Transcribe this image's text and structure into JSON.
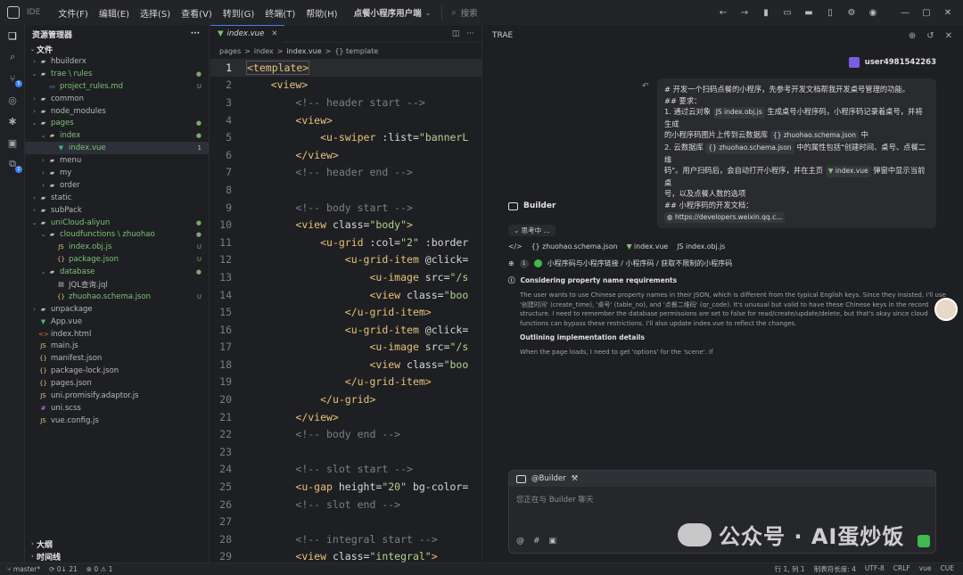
{
  "titlebar": {
    "ide_label": "IDE",
    "menus": [
      "文件(F)",
      "编辑(E)",
      "选择(S)",
      "查看(V)",
      "转到(G)",
      "终端(T)",
      "帮助(H)"
    ],
    "project": "点餐小程序用户端",
    "search_label": "搜索"
  },
  "sidebar": {
    "title": "资源管理器",
    "section": "文件",
    "tree": [
      {
        "depth": 0,
        "type": "folder",
        "name": "hbuilderx",
        "open": false
      },
      {
        "depth": 0,
        "type": "folder",
        "name": "trae \\ rules",
        "open": true,
        "color": "green",
        "dot": true
      },
      {
        "depth": 1,
        "type": "md",
        "name": "project_rules.md",
        "color": "green",
        "status": "U"
      },
      {
        "depth": 0,
        "type": "folder",
        "name": "common",
        "open": false
      },
      {
        "depth": 0,
        "type": "folder",
        "name": "node_modules",
        "open": false
      },
      {
        "depth": 0,
        "type": "folder",
        "name": "pages",
        "open": true,
        "color": "green",
        "dot": true
      },
      {
        "depth": 1,
        "type": "folder",
        "name": "index",
        "open": true,
        "color": "green",
        "dot": true
      },
      {
        "depth": 2,
        "type": "vue",
        "name": "index.vue",
        "color": "green",
        "status": "1",
        "selected": true
      },
      {
        "depth": 1,
        "type": "folder",
        "name": "menu",
        "open": false
      },
      {
        "depth": 1,
        "type": "folder",
        "name": "my",
        "open": false
      },
      {
        "depth": 1,
        "type": "folder",
        "name": "order",
        "open": false
      },
      {
        "depth": 0,
        "type": "folder",
        "name": "static",
        "open": false
      },
      {
        "depth": 0,
        "type": "folder",
        "name": "subPack",
        "open": false
      },
      {
        "depth": 0,
        "type": "folder",
        "name": "uniCloud-aliyun",
        "open": true,
        "color": "green",
        "dot": true
      },
      {
        "depth": 1,
        "type": "folder",
        "name": "cloudfunctions \\ zhuohao",
        "open": true,
        "color": "green",
        "dot": true
      },
      {
        "depth": 2,
        "type": "js",
        "name": "index.obj.js",
        "color": "green",
        "status": "U"
      },
      {
        "depth": 2,
        "type": "json",
        "name": "package.json",
        "color": "green",
        "status": "U"
      },
      {
        "depth": 1,
        "type": "folder",
        "name": "database",
        "open": true,
        "color": "green",
        "dot": true
      },
      {
        "depth": 2,
        "type": "jql",
        "name": "JQL查询.jql"
      },
      {
        "depth": 2,
        "type": "json",
        "name": "zhuohao.schema.json",
        "color": "green",
        "status": "U"
      },
      {
        "depth": 0,
        "type": "folder",
        "name": "unpackage",
        "open": false
      },
      {
        "depth": 0,
        "type": "vue",
        "name": "App.vue"
      },
      {
        "depth": 0,
        "type": "html",
        "name": "index.html"
      },
      {
        "depth": 0,
        "type": "js",
        "name": "main.js"
      },
      {
        "depth": 0,
        "type": "json",
        "name": "manifest.json"
      },
      {
        "depth": 0,
        "type": "json",
        "name": "package-lock.json"
      },
      {
        "depth": 0,
        "type": "json",
        "name": "pages.json"
      },
      {
        "depth": 0,
        "type": "js",
        "name": "uni.promisify.adaptor.js"
      },
      {
        "depth": 0,
        "type": "css",
        "name": "uni.scss"
      },
      {
        "depth": 0,
        "type": "js",
        "name": "vue.config.js"
      }
    ],
    "footer": [
      "大纲",
      "时间线"
    ]
  },
  "editor": {
    "tab": "index.vue",
    "breadcrumb": [
      "pages",
      ">",
      "index",
      ">",
      "index.vue",
      ">",
      "{} template"
    ],
    "lines": [
      {
        "n": "1",
        "cur": true,
        "parts": [
          [
            "c-tag",
            "<template>"
          ]
        ]
      },
      {
        "n": "2",
        "parts": [
          [
            "ct",
            "    "
          ],
          [
            "c-tag",
            "<view>"
          ]
        ]
      },
      {
        "n": "3",
        "parts": [
          [
            "ct",
            "        "
          ],
          [
            "c-cmt",
            "<!-- header start -->"
          ]
        ]
      },
      {
        "n": "4",
        "parts": [
          [
            "ct",
            "        "
          ],
          [
            "c-tag",
            "<view>"
          ]
        ]
      },
      {
        "n": "5",
        "parts": [
          [
            "ct",
            "            "
          ],
          [
            "c-tag",
            "<u-swiper "
          ],
          [
            "c-attr",
            ":list="
          ],
          [
            "c-str",
            "\"bannerL"
          ]
        ]
      },
      {
        "n": "6",
        "parts": [
          [
            "ct",
            "        "
          ],
          [
            "c-tag",
            "</view>"
          ]
        ]
      },
      {
        "n": "7",
        "parts": [
          [
            "ct",
            "        "
          ],
          [
            "c-cmt",
            "<!-- header end -->"
          ]
        ]
      },
      {
        "n": "8",
        "parts": []
      },
      {
        "n": "9",
        "parts": [
          [
            "ct",
            "        "
          ],
          [
            "c-cmt",
            "<!-- body start -->"
          ]
        ]
      },
      {
        "n": "10",
        "parts": [
          [
            "ct",
            "        "
          ],
          [
            "c-tag",
            "<view "
          ],
          [
            "c-attr",
            "class="
          ],
          [
            "c-str",
            "\"body\""
          ],
          [
            "c-tag",
            ">"
          ]
        ]
      },
      {
        "n": "11",
        "parts": [
          [
            "ct",
            "            "
          ],
          [
            "c-tag",
            "<u-grid "
          ],
          [
            "c-attr",
            ":col="
          ],
          [
            "c-str",
            "\"2\" "
          ],
          [
            "c-attr",
            ":border"
          ]
        ]
      },
      {
        "n": "12",
        "parts": [
          [
            "ct",
            "                "
          ],
          [
            "c-tag",
            "<u-grid-item "
          ],
          [
            "c-attr",
            "@click="
          ]
        ]
      },
      {
        "n": "13",
        "parts": [
          [
            "ct",
            "                    "
          ],
          [
            "c-tag",
            "<u-image "
          ],
          [
            "c-attr",
            "src="
          ],
          [
            "c-str",
            "\"/s"
          ]
        ]
      },
      {
        "n": "14",
        "parts": [
          [
            "ct",
            "                    "
          ],
          [
            "c-tag",
            "<view "
          ],
          [
            "c-attr",
            "class="
          ],
          [
            "c-str",
            "\"boo"
          ]
        ]
      },
      {
        "n": "15",
        "parts": [
          [
            "ct",
            "                "
          ],
          [
            "c-tag",
            "</u-grid-item>"
          ]
        ]
      },
      {
        "n": "16",
        "parts": [
          [
            "ct",
            "                "
          ],
          [
            "c-tag",
            "<u-grid-item "
          ],
          [
            "c-attr",
            "@click="
          ]
        ]
      },
      {
        "n": "17",
        "parts": [
          [
            "ct",
            "                    "
          ],
          [
            "c-tag",
            "<u-image "
          ],
          [
            "c-attr",
            "src="
          ],
          [
            "c-str",
            "\"/s"
          ]
        ]
      },
      {
        "n": "18",
        "parts": [
          [
            "ct",
            "                    "
          ],
          [
            "c-tag",
            "<view "
          ],
          [
            "c-attr",
            "class="
          ],
          [
            "c-str",
            "\"boo"
          ]
        ]
      },
      {
        "n": "19",
        "parts": [
          [
            "ct",
            "                "
          ],
          [
            "c-tag",
            "</u-grid-item>"
          ]
        ]
      },
      {
        "n": "20",
        "parts": [
          [
            "ct",
            "            "
          ],
          [
            "c-tag",
            "</u-grid>"
          ]
        ]
      },
      {
        "n": "21",
        "parts": [
          [
            "ct",
            "        "
          ],
          [
            "c-tag",
            "</view>"
          ]
        ]
      },
      {
        "n": "22",
        "parts": [
          [
            "ct",
            "        "
          ],
          [
            "c-cmt",
            "<!-- body end -->"
          ]
        ]
      },
      {
        "n": "23",
        "parts": []
      },
      {
        "n": "24",
        "parts": [
          [
            "ct",
            "        "
          ],
          [
            "c-cmt",
            "<!-- slot start -->"
          ]
        ]
      },
      {
        "n": "25",
        "parts": [
          [
            "ct",
            "        "
          ],
          [
            "c-tag",
            "<u-gap "
          ],
          [
            "c-attr",
            "height="
          ],
          [
            "c-str",
            "\"20\" "
          ],
          [
            "c-attr",
            "bg-color="
          ]
        ]
      },
      {
        "n": "26",
        "parts": [
          [
            "ct",
            "        "
          ],
          [
            "c-cmt",
            "<!-- slot end -->"
          ]
        ]
      },
      {
        "n": "27",
        "parts": []
      },
      {
        "n": "28",
        "parts": [
          [
            "ct",
            "        "
          ],
          [
            "c-cmt",
            "<!-- integral start -->"
          ]
        ]
      },
      {
        "n": "29",
        "parts": [
          [
            "ct",
            "        "
          ],
          [
            "c-tag",
            "<view "
          ],
          [
            "c-attr",
            "class="
          ],
          [
            "c-str",
            "\"integral\""
          ],
          [
            "c-tag",
            ">"
          ]
        ]
      }
    ]
  },
  "trae": {
    "title": "TRAE",
    "username": "user4981542263",
    "request": {
      "l1": "# 开发一个扫码点餐的小程序，先参考开发文档帮我开发桌号管理的功能。",
      "l2": "## 要求：",
      "l3a": "1. 通过云对象",
      "chip1": "JS index.obj.js",
      "l3b": "生成桌号小程序码，小程序码记录着桌号，并将生成",
      "l4a": "的小程序码图片上传到云数据库",
      "chip2": "{} zhuohao.schema.json",
      "l4b": "中",
      "l5a": "2. 云数据库",
      "chip3": "{} zhuohao.schema.json",
      "l5b": "中的属性包括\"创建时间、桌号、点餐二维",
      "l6a": "码\"。用户扫码后，会自动打开小程序，并在主页",
      "chip4": "index.vue",
      "l6b": "弹窗中显示当前桌",
      "l7": "号，以及点餐人数的选项",
      "l8": "## 小程序码的开发文档：",
      "link": "https://developers.weixin.qq.c..."
    },
    "builder_label": "Builder",
    "thinking": "思考中 ...",
    "context_files": [
      "{} zhuohao.schema.json",
      "index.vue",
      "JS index.obj.js"
    ],
    "step_number": "1",
    "step_text": "小程序码与小程序链接 / 小程序码 / 获取不限制的小程序码",
    "reasoning_title": "Considering property name requirements",
    "reasoning_text": "The user wants to use Chinese property names in their JSON, which is different from the typical English keys. Since they insisted, I'll use '创建时间' (create_time), '桌号' (table_no), and '点餐二维码' (qr_code). It's unusual but valid to have these Chinese keys in the record structure. I need to remember the database permissions are set to false for read/create/update/delete, but that's okay since cloud functions can bypass these restrictions. I'll also update index.vue to reflect the changes.",
    "sub_title": "Outlining implementation details",
    "sub_text": "When the page loads, I need to get 'options' for the 'scene'. If",
    "input_head": "@Builder",
    "input_placeholder": "您正在与 Builder 聊天",
    "input_tools": [
      "@",
      "#",
      "▣"
    ]
  },
  "watermark": "公众号 · AI蛋炒饭",
  "statusbar": {
    "branch": "master*",
    "sync": "0↓ 21",
    "problems": "⊗ 0 ⚠ 1",
    "position": "行 1, 列 1",
    "tab_size": "制表符长度: 4",
    "encoding": "UTF-8",
    "eol": "CRLF",
    "lang": "vue",
    "ime": "CUE"
  },
  "colors": {
    "accent": "#3b82f6",
    "green": "#3fb950"
  }
}
